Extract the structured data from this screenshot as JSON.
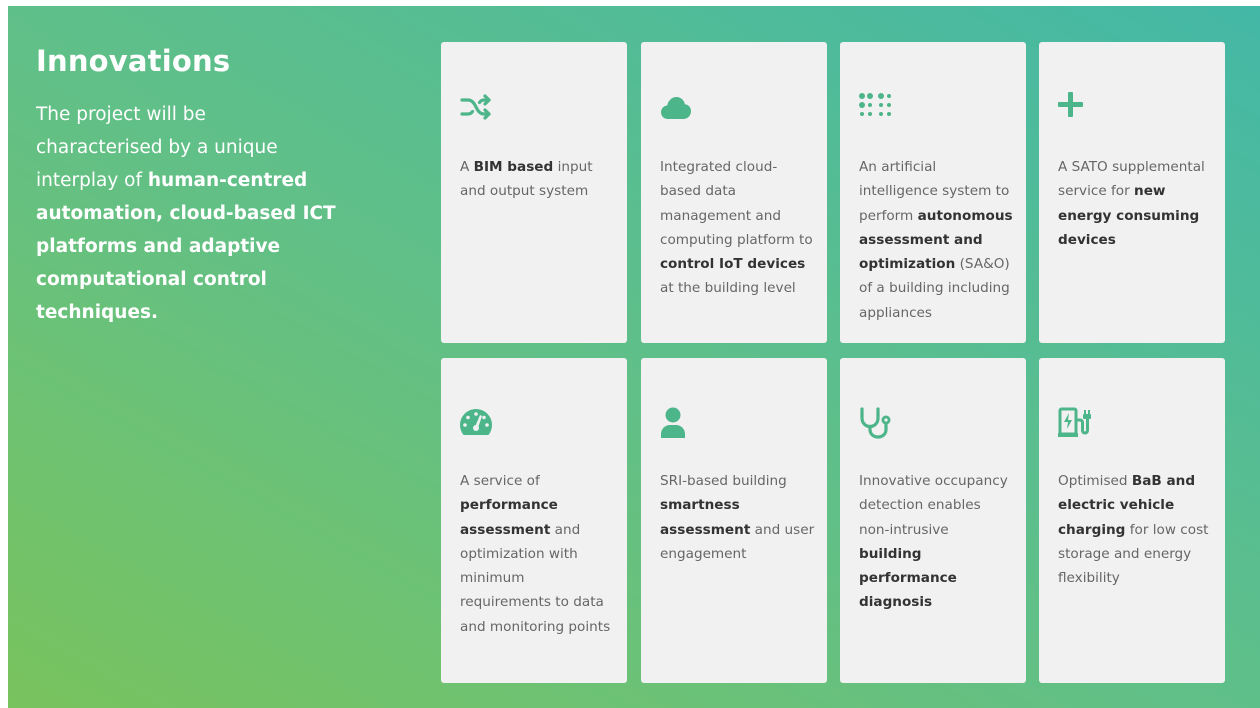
{
  "colors": {
    "accent": "#4db58a",
    "card_bg": "#f1f1f1",
    "gradient_start": "#79c35e",
    "gradient_end": "#44b8a6"
  },
  "intro": {
    "title": "Innovations",
    "text_before": "The project will be characterised by a unique interplay of ",
    "text_bold": "human-centred automation, cloud-based ICT platforms and adaptive computational control techniques."
  },
  "cards": [
    {
      "icon": "shuffle-icon",
      "parts": [
        {
          "t": "A ",
          "b": false
        },
        {
          "t": "BIM based",
          "b": true
        },
        {
          "t": " input and output system",
          "b": false
        }
      ]
    },
    {
      "icon": "cloud-icon",
      "parts": [
        {
          "t": "Integrated cloud-based data management and computing platform to ",
          "b": false
        },
        {
          "t": "control IoT devices",
          "b": true
        },
        {
          "t": " at the building level",
          "b": false
        }
      ]
    },
    {
      "icon": "braille-icon",
      "parts": [
        {
          "t": "An artificial intelligence system to perform ",
          "b": false
        },
        {
          "t": "autonomous assessment and optimization",
          "b": true
        },
        {
          "t": " (SA&O) of a building including appliances",
          "b": false
        }
      ]
    },
    {
      "icon": "plus-icon",
      "parts": [
        {
          "t": "A SATO supplemental service for ",
          "b": false
        },
        {
          "t": "new energy consuming devices",
          "b": true
        }
      ]
    },
    {
      "icon": "gauge-icon",
      "parts": [
        {
          "t": "A service of ",
          "b": false
        },
        {
          "t": "performance assessment",
          "b": true
        },
        {
          "t": " and optimization with minimum requirements to data and monitoring points",
          "b": false
        }
      ]
    },
    {
      "icon": "user-icon",
      "parts": [
        {
          "t": "SRI-based building ",
          "b": false
        },
        {
          "t": "smartness assessment",
          "b": true
        },
        {
          "t": " and user engagement",
          "b": false
        }
      ]
    },
    {
      "icon": "stethoscope-icon",
      "parts": [
        {
          "t": "Innovative occupancy detection enables non-intrusive ",
          "b": false
        },
        {
          "t": "building performance diagnosis",
          "b": true
        }
      ]
    },
    {
      "icon": "charging-station-icon",
      "parts": [
        {
          "t": "Optimised ",
          "b": false
        },
        {
          "t": "BaB and electric vehicle charging",
          "b": true
        },
        {
          "t": " for low cost storage and energy flexibility",
          "b": false
        }
      ]
    }
  ]
}
